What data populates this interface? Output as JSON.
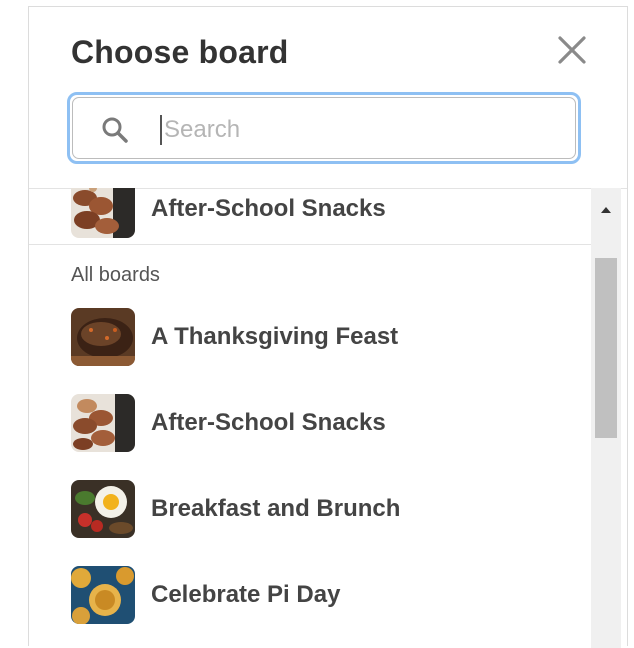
{
  "dialog": {
    "title": "Choose board",
    "close_icon": "close-icon"
  },
  "search": {
    "placeholder": "Search",
    "value": "",
    "icon": "search-icon"
  },
  "recent_boards": [
    {
      "name": "After-School Snacks",
      "thumb": "snacks"
    }
  ],
  "all_boards_label": "All boards",
  "all_boards": [
    {
      "name": "A Thanksgiving Feast",
      "thumb": "thanksgiving"
    },
    {
      "name": "After-School Snacks",
      "thumb": "snacks"
    },
    {
      "name": "Breakfast and Brunch",
      "thumb": "breakfast"
    },
    {
      "name": "Celebrate Pi Day",
      "thumb": "pie"
    }
  ],
  "colors": {
    "focus_ring": "#8ec0f3",
    "text": "#444444",
    "scroll_thumb": "#c0c0c0"
  }
}
